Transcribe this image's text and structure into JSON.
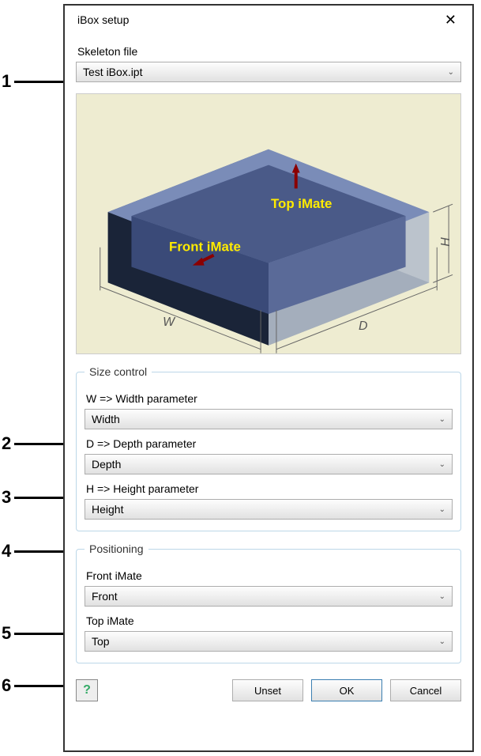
{
  "callouts": {
    "c1": "1",
    "c2": "2",
    "c3": "3",
    "c4": "4",
    "c5": "5",
    "c6": "6"
  },
  "dialog": {
    "title": "iBox setup"
  },
  "skeleton": {
    "label": "Skeleton file",
    "value": "Test iBox.ipt"
  },
  "preview": {
    "top_label": "Top iMate",
    "front_label": "Front iMate",
    "w_dim": "W",
    "d_dim": "D",
    "h_dim": "H"
  },
  "size_control": {
    "legend": "Size control",
    "w_label": "W => Width parameter",
    "w_value": "Width",
    "d_label": "D => Depth parameter",
    "d_value": "Depth",
    "h_label": "H => Height parameter",
    "h_value": "Height"
  },
  "positioning": {
    "legend": "Positioning",
    "front_label": "Front iMate",
    "front_value": "Front",
    "top_label": "Top iMate",
    "top_value": "Top"
  },
  "buttons": {
    "help": "?",
    "unset": "Unset",
    "ok": "OK",
    "cancel": "Cancel"
  }
}
